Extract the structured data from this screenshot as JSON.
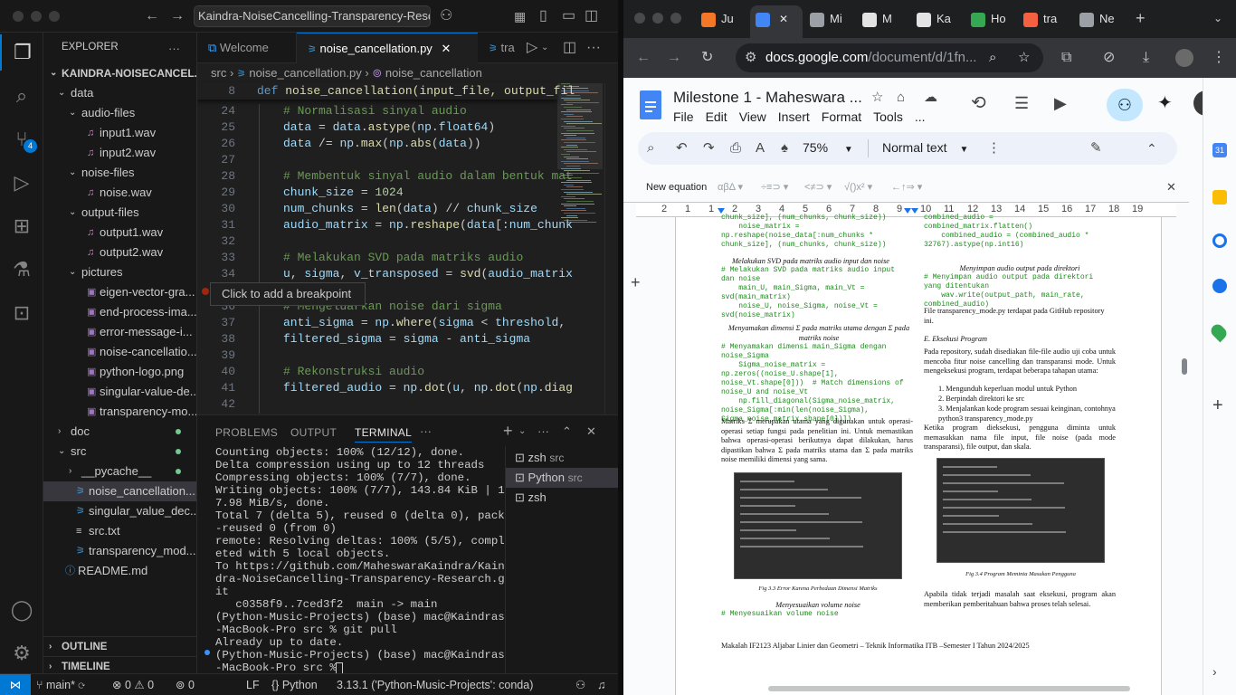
{
  "vscode": {
    "command_center": "Kaindra-NoiseCancelling-Transparency-Resea",
    "explorer_title": "EXPLORER",
    "root": "KAINDRA-NOISECANCEL...",
    "tree": [
      {
        "label": "data",
        "kind": "folder-open",
        "depth": 1
      },
      {
        "label": "audio-files",
        "kind": "folder-open",
        "depth": 2
      },
      {
        "label": "input1.wav",
        "kind": "audio",
        "depth": 3
      },
      {
        "label": "input2.wav",
        "kind": "audio",
        "depth": 3
      },
      {
        "label": "noise-files",
        "kind": "folder-open",
        "depth": 2
      },
      {
        "label": "noise.wav",
        "kind": "audio",
        "depth": 3
      },
      {
        "label": "output-files",
        "kind": "folder-open",
        "depth": 2
      },
      {
        "label": "output1.wav",
        "kind": "audio",
        "depth": 3
      },
      {
        "label": "output2.wav",
        "kind": "audio",
        "depth": 3
      },
      {
        "label": "pictures",
        "kind": "folder-open",
        "depth": 2
      },
      {
        "label": "eigen-vector-gra...",
        "kind": "image",
        "depth": 3
      },
      {
        "label": "end-process-ima...",
        "kind": "image",
        "depth": 3
      },
      {
        "label": "error-message-i...",
        "kind": "image",
        "depth": 3
      },
      {
        "label": "noise-cancellatio...",
        "kind": "image",
        "depth": 3
      },
      {
        "label": "python-logo.png",
        "kind": "image",
        "depth": 3
      },
      {
        "label": "singular-value-de...",
        "kind": "image",
        "depth": 3
      },
      {
        "label": "transparency-mo...",
        "kind": "image",
        "depth": 3
      },
      {
        "label": "doc",
        "kind": "folder-closed",
        "depth": 1
      },
      {
        "label": "src",
        "kind": "folder-open",
        "depth": 1
      },
      {
        "label": "__pycache__",
        "kind": "folder-closed",
        "depth": 2
      },
      {
        "label": "noise_cancellation....",
        "kind": "python",
        "depth": 2,
        "selected": true
      },
      {
        "label": "singular_value_dec...",
        "kind": "python",
        "depth": 2
      },
      {
        "label": "src.txt",
        "kind": "text",
        "depth": 2
      },
      {
        "label": "transparency_mod...",
        "kind": "python",
        "depth": 2
      },
      {
        "label": "README.md",
        "kind": "info",
        "depth": 1
      }
    ],
    "outline": "OUTLINE",
    "timeline": "TIMELINE",
    "source_control_badge": "4",
    "tabs": [
      {
        "label": "Welcome",
        "active": false
      },
      {
        "label": "noise_cancellation.py",
        "active": true
      },
      {
        "label": "tra",
        "active": false
      }
    ],
    "breadcrumb": [
      "src",
      "noise_cancellation.py",
      "noise_cancellation"
    ],
    "sticky_line": {
      "num": "8",
      "code": "def noise_cancellation(input_file, output_fil"
    },
    "code": [
      {
        "num": "24",
        "segs": [
          {
            "t": "# Normalisasi sinyal audio",
            "c": "cm"
          }
        ]
      },
      {
        "num": "25",
        "segs": [
          {
            "t": "data",
            "c": "va"
          },
          {
            "t": " = ",
            "c": ""
          },
          {
            "t": "data",
            "c": "va"
          },
          {
            "t": ".",
            "c": ""
          },
          {
            "t": "astype",
            "c": "fn"
          },
          {
            "t": "(",
            "c": ""
          },
          {
            "t": "np",
            "c": "va"
          },
          {
            "t": ".",
            "c": ""
          },
          {
            "t": "float64",
            "c": "va"
          },
          {
            "t": ")",
            "c": ""
          }
        ]
      },
      {
        "num": "26",
        "segs": [
          {
            "t": "data",
            "c": "va"
          },
          {
            "t": " /= ",
            "c": ""
          },
          {
            "t": "np",
            "c": "va"
          },
          {
            "t": ".",
            "c": ""
          },
          {
            "t": "max",
            "c": "fn"
          },
          {
            "t": "(",
            "c": ""
          },
          {
            "t": "np",
            "c": "va"
          },
          {
            "t": ".",
            "c": ""
          },
          {
            "t": "abs",
            "c": "fn"
          },
          {
            "t": "(",
            "c": ""
          },
          {
            "t": "data",
            "c": "va"
          },
          {
            "t": "))",
            "c": ""
          }
        ]
      },
      {
        "num": "27",
        "segs": []
      },
      {
        "num": "28",
        "segs": [
          {
            "t": "# Membentuk sinyal audio dalam bentuk mat",
            "c": "cm"
          }
        ]
      },
      {
        "num": "29",
        "segs": [
          {
            "t": "chunk_size",
            "c": "va"
          },
          {
            "t": " = ",
            "c": ""
          },
          {
            "t": "1024",
            "c": "nu"
          }
        ]
      },
      {
        "num": "30",
        "segs": [
          {
            "t": "num_chunks",
            "c": "va"
          },
          {
            "t": " = ",
            "c": ""
          },
          {
            "t": "len",
            "c": "fn"
          },
          {
            "t": "(",
            "c": ""
          },
          {
            "t": "data",
            "c": "va"
          },
          {
            "t": ") // ",
            "c": ""
          },
          {
            "t": "chunk_size",
            "c": "va"
          }
        ]
      },
      {
        "num": "31",
        "segs": [
          {
            "t": "audio_matrix",
            "c": "va"
          },
          {
            "t": " = ",
            "c": ""
          },
          {
            "t": "np",
            "c": "va"
          },
          {
            "t": ".",
            "c": ""
          },
          {
            "t": "reshape",
            "c": "fn"
          },
          {
            "t": "(",
            "c": ""
          },
          {
            "t": "data",
            "c": "va"
          },
          {
            "t": "[:",
            "c": ""
          },
          {
            "t": "num_chunk",
            "c": "va"
          }
        ]
      },
      {
        "num": "32",
        "segs": []
      },
      {
        "num": "33",
        "segs": [
          {
            "t": "# Melakukan SVD pada matriks audio",
            "c": "cm"
          }
        ]
      },
      {
        "num": "34",
        "segs": [
          {
            "t": "u",
            "c": "va"
          },
          {
            "t": ", ",
            "c": ""
          },
          {
            "t": "sigma",
            "c": "va"
          },
          {
            "t": ", ",
            "c": ""
          },
          {
            "t": "v_transposed",
            "c": "va"
          },
          {
            "t": " = ",
            "c": ""
          },
          {
            "t": "svd",
            "c": "fn"
          },
          {
            "t": "(",
            "c": ""
          },
          {
            "t": "audio_matrix",
            "c": "va"
          }
        ]
      },
      {
        "num": "35",
        "segs": []
      },
      {
        "num": "36",
        "segs": [
          {
            "t": "# Mengeluarkan noise dari sigma",
            "c": "cm"
          }
        ]
      },
      {
        "num": "37",
        "segs": [
          {
            "t": "anti_sigma",
            "c": "va"
          },
          {
            "t": " = ",
            "c": ""
          },
          {
            "t": "np",
            "c": "va"
          },
          {
            "t": ".",
            "c": ""
          },
          {
            "t": "where",
            "c": "fn"
          },
          {
            "t": "(",
            "c": ""
          },
          {
            "t": "sigma",
            "c": "va"
          },
          {
            "t": " < ",
            "c": ""
          },
          {
            "t": "threshold",
            "c": "va"
          },
          {
            "t": ",",
            "c": ""
          }
        ]
      },
      {
        "num": "38",
        "segs": [
          {
            "t": "filtered_sigma",
            "c": "va"
          },
          {
            "t": " = ",
            "c": ""
          },
          {
            "t": "sigma",
            "c": "va"
          },
          {
            "t": " - ",
            "c": ""
          },
          {
            "t": "anti_sigma",
            "c": "va"
          }
        ]
      },
      {
        "num": "39",
        "segs": []
      },
      {
        "num": "40",
        "segs": [
          {
            "t": "# Rekonstruksi audio",
            "c": "cm"
          }
        ]
      },
      {
        "num": "41",
        "segs": [
          {
            "t": "filtered_audio",
            "c": "va"
          },
          {
            "t": " = ",
            "c": ""
          },
          {
            "t": "np",
            "c": "va"
          },
          {
            "t": ".",
            "c": ""
          },
          {
            "t": "dot",
            "c": "fn"
          },
          {
            "t": "(",
            "c": ""
          },
          {
            "t": "u",
            "c": "va"
          },
          {
            "t": ", ",
            "c": ""
          },
          {
            "t": "np",
            "c": "va"
          },
          {
            "t": ".",
            "c": ""
          },
          {
            "t": "dot",
            "c": "fn"
          },
          {
            "t": "(",
            "c": ""
          },
          {
            "t": "np",
            "c": "va"
          },
          {
            "t": ".",
            "c": ""
          },
          {
            "t": "diag",
            "c": "fn"
          }
        ]
      },
      {
        "num": "42",
        "segs": []
      }
    ],
    "hover_tooltip": "Click to add a breakpoint",
    "panel_tabs": [
      "PROBLEMS",
      "OUTPUT",
      "TERMINAL"
    ],
    "terminal_lines": [
      "Counting objects: 100% (12/12), done.",
      "Delta compression using up to 12 threads",
      "Compressing objects: 100% (7/7), done.",
      "Writing objects: 100% (7/7), 143.84 KiB | 1",
      "7.98 MiB/s, done.",
      "Total 7 (delta 5), reused 0 (delta 0), pack",
      "-reused 0 (from 0)",
      "remote: Resolving deltas: 100% (5/5), compl",
      "eted with 5 local objects.",
      "To https://github.com/MaheswaraKaindra/Kain",
      "dra-NoiseCancelling-Transparency-Research.g",
      "it",
      "   c0358f9..7ced3f2  main -> main",
      "(Python-Music-Projects) (base) mac@Kaindras",
      "-MacBook-Pro src % git pull",
      "Already up to date.",
      "(Python-Music-Projects) (base) mac@Kaindras",
      "-MacBook-Pro src % "
    ],
    "terminals": [
      {
        "name": "zsh",
        "dir": "src"
      },
      {
        "name": "Python",
        "dir": "src"
      },
      {
        "name": "zsh",
        "dir": ""
      }
    ],
    "status": {
      "branch": "main*",
      "errors": "0",
      "warnings": "0",
      "ports": "0",
      "eol": "LF",
      "lang": "Python",
      "interpreter": "3.13.1 ('Python-Music-Projects': conda)"
    }
  },
  "chrome": {
    "tabs": [
      {
        "label": "Ju",
        "color": "#f37726"
      },
      {
        "label": "",
        "color": "#4285f4",
        "active": true
      },
      {
        "label": "Mi",
        "color": "#9aa0a6"
      },
      {
        "label": "M",
        "color": "#e3e3e3"
      },
      {
        "label": "Ka",
        "color": "#e3e3e3"
      },
      {
        "label": "Ho",
        "color": "#34a853"
      },
      {
        "label": "tra",
        "color": "#f56040"
      },
      {
        "label": "Ne",
        "color": "#9aa0a6"
      }
    ],
    "url_host": "docs.google.com",
    "url_path": "/document/d/1fn...",
    "doc_title": "Milestone 1 - Maheswara ...",
    "menus": [
      "File",
      "Edit",
      "View",
      "Insert",
      "Format",
      "Tools",
      "..."
    ],
    "zoom": "75%",
    "style": "Normal text",
    "eq_label": "New equation",
    "eq_groups": [
      "αβΔ",
      "÷≡⊃",
      "<≠⊃",
      "√()x²",
      "←↑⇒"
    ],
    "ruler_nums": [
      "2",
      "1",
      "1",
      "2",
      "3",
      "4",
      "5",
      "6",
      "7",
      "8",
      "9",
      "10",
      "11",
      "12",
      "13",
      "14",
      "15",
      "16",
      "17",
      "18",
      "19"
    ],
    "page": {
      "left_code_top": "chunk_size], (num_chunks, chunk_size))\n    noise_matrix =\nnp.reshape(noise_data[:num_chunks *\nchunk_size], (num_chunks, chunk_size))",
      "left_h1": "Melakukan SVD pada matriks audio input dan noise",
      "left_code_1": "# Melakukan SVD pada matriks audio input\ndan noise\n    main_U, main_Sigma, main_Vt =\nsvd(main_matrix)\n    noise_U, noise_Sigma, noise_Vt =\nsvd(noise_matrix)",
      "left_h2": "Menyamakan dimensi Σ pada matriks utama dengan Σ pada matriks noise",
      "left_code_2": "# Menyamakan dimensi main_Sigma dengan\nnoise_Sigma\n    Sigma_noise_matrix =\nnp.zeros((noise_U.shape[1],\nnoise_Vt.shape[0]))  # Match dimensions of\nnoise_U and noise_Vt\n    np.fill_diagonal(Sigma_noise_matrix,\nnoise_Sigma[:min(len(noise_Sigma),\nSigma_noise_matrix.shape[0])])",
      "left_para": "Matriks Σ merupakan utama yang digunakan untuk operasi-operasi setiap fungsi pada penelitian ini. Untuk memastikan bahwa operasi-operasi berikutnya dapat dilakukan, harus dipastikan bahwa Σ pada matriks utama dan Σ pada matriks noise memiliki dimensi yang sama.",
      "fig3": "Fig 3.3 Error Karena Perbedaan Dimensi Matriks",
      "left_h3": "Menyesuaikan volume noise",
      "left_code_3": "# Menyesuaikan volume noise",
      "right_code_top": "combined_audio =\ncombined_matrix.flatten()\n    combined_audio = (combined_audio *\n32767).astype(np.int16)",
      "right_h1": "Menyimpan audio output pada direktori",
      "right_code_1": "# Menyimpan audio output pada direktori\nyang ditentukan\n    wav.write(output_path, main_rate,\ncombined_audio)",
      "right_file": "File transparency_mode.py terdapat pada GitHub repository ini.",
      "right_h2": "E. Eksekusi Program",
      "right_para1": "Pada repository, sudah disediakan file-file audio uji coba untuk mencoba fitur noise cancelling dan transparansi mode. Untuk mengeksekusi program, terdapat beberapa tahapan utama:",
      "list": [
        "1.   Mengunduh keperluan modul untuk Python",
        "2.   Berpindah direktori ke src",
        "3.   Menjalankan kode program sesuai keinginan, contohnya python3 transparency_mode.py"
      ],
      "right_para2": "Ketika program dieksekusi, pengguna diminta untuk memasukkan nama file input, file noise (pada mode transparansi), file output, dan skala.",
      "fig4": "Fig 3.4 Program Meminta Masukan Pengguna",
      "right_para3": "Apabila tidak terjadi masalah saat eksekusi, program akan memberikan pemberitahuan bahwa proses telah selesai.",
      "footer": "Makalah IF2123 Aljabar Linier dan Geometri – Teknik Informatika ITB –Semester I Tahun 2024/2025"
    }
  }
}
